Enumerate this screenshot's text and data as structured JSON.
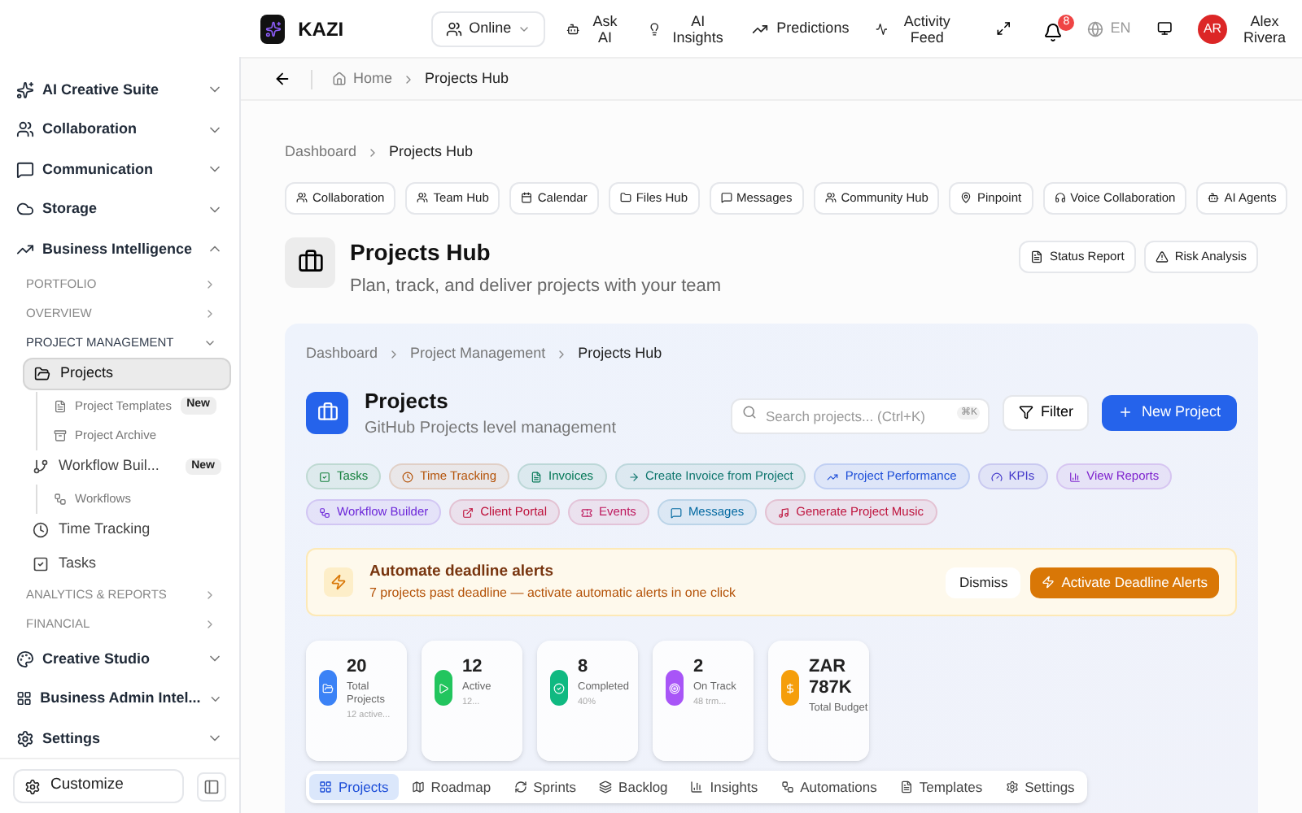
{
  "header": {
    "logo_text": "KAZI",
    "status": "Online",
    "nav": [
      {
        "label": "Ask AI"
      },
      {
        "label": "AI Insights"
      },
      {
        "label": "Predictions"
      },
      {
        "label": "Activity Feed"
      }
    ],
    "notifications": "8",
    "language": "EN",
    "user": {
      "initials": "AR",
      "name": "Alex Rivera"
    }
  },
  "breadcrumb_bar": {
    "items": [
      "Home",
      "Projects Hub"
    ]
  },
  "sidebar": {
    "groups": [
      {
        "label": "AI Creative Suite",
        "expanded": false
      },
      {
        "label": "Collaboration",
        "expanded": false
      },
      {
        "label": "Communication",
        "expanded": false
      },
      {
        "label": "Storage",
        "expanded": false
      },
      {
        "label": "Business Intelligence",
        "expanded": true,
        "sections": [
          {
            "label": "PORTFOLIO",
            "expanded": false
          },
          {
            "label": "OVERVIEW",
            "expanded": false
          },
          {
            "label": "PROJECT MANAGEMENT",
            "expanded": true,
            "items": [
              {
                "label": "Projects",
                "selected": true,
                "children": [
                  {
                    "label": "Project Templates",
                    "badge": "New"
                  },
                  {
                    "label": "Project Archive"
                  }
                ]
              },
              {
                "label": "Workflow Buil...",
                "selected": false,
                "badge": "New",
                "children": [
                  {
                    "label": "Workflows"
                  }
                ]
              },
              {
                "label": "Time Tracking",
                "selected": false
              },
              {
                "label": "Tasks",
                "selected": false
              }
            ]
          },
          {
            "label": "ANALYTICS & REPORTS",
            "expanded": false
          },
          {
            "label": "FINANCIAL",
            "expanded": false
          }
        ]
      },
      {
        "label": "Creative Studio",
        "expanded": false
      },
      {
        "label": "Business Admin Intel...",
        "expanded": false
      },
      {
        "label": "Settings",
        "expanded": false
      }
    ],
    "customize": "Customize"
  },
  "page": {
    "breadcrumb": [
      "Dashboard",
      "Projects Hub"
    ],
    "quick_links": [
      "Collaboration",
      "Team Hub",
      "Calendar",
      "Files Hub",
      "Messages",
      "Community Hub",
      "Pinpoint",
      "Voice Collaboration",
      "AI Agents"
    ],
    "title": "Projects Hub",
    "subtitle": "Plan, track, and deliver projects with your team",
    "actions": [
      "Status Report",
      "Risk Analysis"
    ]
  },
  "hub": {
    "breadcrumb": [
      "Dashboard",
      "Project Management",
      "Projects Hub"
    ],
    "title": "Projects",
    "subtitle": "GitHub Projects level management",
    "search": {
      "placeholder": "Search projects... (Ctrl+K)",
      "shortcut": "⌘K"
    },
    "filter": "Filter",
    "new_button": "New Project",
    "chips": [
      {
        "label": "Tasks",
        "color": "#15803d"
      },
      {
        "label": "Time Tracking",
        "color": "#b45309"
      },
      {
        "label": "Invoices",
        "color": "#047857"
      },
      {
        "label": "Create Invoice from Project",
        "color": "#0f766e"
      },
      {
        "label": "Project Performance",
        "color": "#1d4ed8"
      },
      {
        "label": "KPIs",
        "color": "#4338ca"
      },
      {
        "label": "View Reports",
        "color": "#7e22ce"
      },
      {
        "label": "Workflow Builder",
        "color": "#6d28d9"
      },
      {
        "label": "Client Portal",
        "color": "#be123c"
      },
      {
        "label": "Events",
        "color": "#be185d"
      },
      {
        "label": "Messages",
        "color": "#0369a1"
      },
      {
        "label": "Generate Project Music",
        "color": "#be123c"
      }
    ],
    "alert": {
      "title": "Automate deadline alerts",
      "text": "7 projects past deadline — activate automatic alerts in one click",
      "dismiss": "Dismiss",
      "action": "Activate Deadline Alerts"
    },
    "stats": [
      {
        "value": "20",
        "label": "Total Projects",
        "note": "12 active...",
        "color": "#3b82f6"
      },
      {
        "value": "12",
        "label": "Active",
        "note": "12...",
        "color": "#22c55e"
      },
      {
        "value": "8",
        "label": "Completed",
        "note": "40%",
        "color": "#10b981"
      },
      {
        "value": "2",
        "label": "On Track",
        "note": "48 trm...",
        "color": "#a855f7"
      },
      {
        "value": "ZAR 787K",
        "label": "Total Budget",
        "color": "#f59e0b"
      }
    ],
    "tabs": [
      {
        "label": "Projects",
        "selected": true
      },
      {
        "label": "Roadmap",
        "selected": false
      },
      {
        "label": "Sprints",
        "selected": false
      },
      {
        "label": "Backlog",
        "selected": false
      },
      {
        "label": "Insights",
        "selected": false
      },
      {
        "label": "Automations",
        "selected": false
      },
      {
        "label": "Templates",
        "selected": false
      },
      {
        "label": "Settings",
        "selected": false
      }
    ]
  }
}
